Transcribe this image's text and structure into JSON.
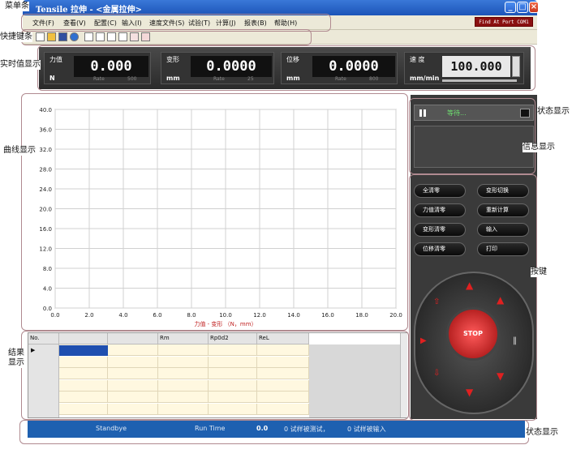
{
  "window": {
    "title": "Tensile 拉伸 - <金属拉伸>"
  },
  "menu": {
    "items": [
      "文件(F)",
      "查看(V)",
      "配置(C)",
      "输入(I)",
      "速度文件(S)",
      "试验(T)",
      "计算(J)",
      "报表(B)",
      "帮助(H)"
    ]
  },
  "port_status": "Find At Port COM1",
  "annotations": {
    "menu_bar": "菜单条",
    "toolbar": "快捷键条",
    "realtime": "实时值显示",
    "curve": "曲线显示",
    "result": "结果显示",
    "state": "状态显示",
    "info": "信息显示",
    "buttons": "按键",
    "status_bottom": "状态显示"
  },
  "realtime": {
    "force": {
      "label": "力值",
      "value": "0.000",
      "unit": "N",
      "rate_label": "Rate",
      "rate": "500"
    },
    "deform": {
      "label": "变形",
      "value": "0.0000",
      "unit": "mm",
      "rate_label": "Rate",
      "rate": "25"
    },
    "disp": {
      "label": "位移",
      "value": "0.0000",
      "unit": "mm",
      "rate_label": "Rate",
      "rate": "800"
    },
    "speed": {
      "label": "速 度",
      "value": "100.000",
      "unit": "mm/min"
    }
  },
  "chart_data": {
    "type": "line",
    "xlabel": "力值 - 变形 （N，mm）",
    "ylabel": "",
    "xlim": [
      0,
      20
    ],
    "ylim": [
      0,
      40
    ],
    "x_ticks": [
      "0.0",
      "2.0",
      "4.0",
      "6.0",
      "8.0",
      "10.0",
      "12.0",
      "14.0",
      "16.0",
      "18.0",
      "20.0"
    ],
    "y_ticks": [
      "0.0",
      "4.0",
      "8.0",
      "12.0",
      "16.0",
      "20.0",
      "24.0",
      "28.0",
      "32.0",
      "36.0",
      "40.0"
    ],
    "grid": true,
    "series": []
  },
  "state_panel": {
    "status_text": "等待..."
  },
  "buttons": {
    "clear_all": "全清零",
    "deform_switch": "变形切换",
    "clear_force": "力值清零",
    "recalc": "重新计算",
    "clear_deform": "变形清零",
    "input": "输入",
    "clear_disp": "位移清零",
    "print": "打印",
    "stop": "STOP"
  },
  "table": {
    "columns": [
      "No.",
      "",
      "Rm",
      "Rp0d2",
      "ReL"
    ]
  },
  "statusbar": {
    "state": "Standbye",
    "runtime_label": "Run Time",
    "runtime_value": "0.0",
    "tested": "0  试样被测试，",
    "entered": "0 试样被输入"
  },
  "colors": {
    "title_bar": "#2a64d0",
    "status_bar": "#1e60b0",
    "panel_dark": "#3a3a3a",
    "stop_red": "#c81818",
    "selected_cell": "#1f4fb0",
    "plot_grid": "#d0d0d0"
  }
}
